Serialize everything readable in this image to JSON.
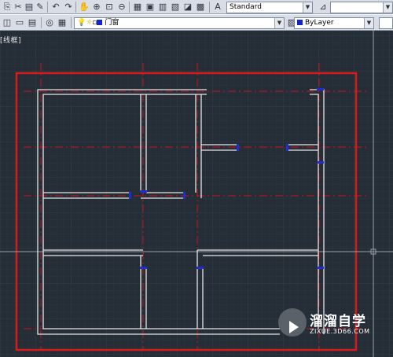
{
  "toolbar_top": {
    "icons": [
      "copy-icon",
      "cut-icon",
      "paste-icon",
      "matchprop-icon",
      "undo-icon",
      "redo-icon",
      "pan-icon",
      "zoom-realtime-icon",
      "zoom-window-icon",
      "zoom-previous-icon",
      "properties-icon",
      "design-center-icon",
      "tool-palettes-icon",
      "sheetset-icon",
      "markup-icon",
      "calculator-icon",
      "text-style-icon"
    ],
    "text_style": "Standard"
  },
  "toolbar_layers": {
    "layer_name": "门窗",
    "color_value": "ByLayer",
    "layer_swatch_color": "#1524c8"
  },
  "viewport": {
    "label": "[线框]"
  },
  "watermark": {
    "title": "溜溜自学",
    "url": "ZIXUE.3D66.COM"
  },
  "colors": {
    "background": "#252d37",
    "walls": "#e6e6e6",
    "axis": "#c8151b",
    "frame": "#d61b1b",
    "doors": "#1e2fd0"
  }
}
